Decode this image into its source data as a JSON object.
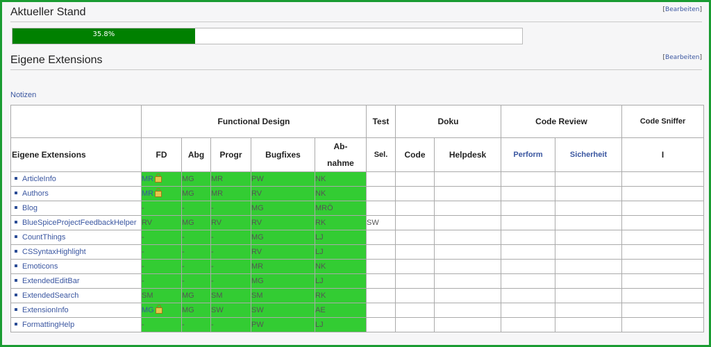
{
  "status": {
    "title": "Aktueller Stand",
    "edit_link": "Bearbeiten",
    "progress_label": "35.8%",
    "progress_value": 35.8
  },
  "extensions": {
    "title": "Eigene Extensions",
    "edit_link": "Bearbeiten",
    "notes_link": "Notizen"
  },
  "table": {
    "group_headers": [
      "Functional Design",
      "Test",
      "Doku",
      "Code Review",
      "Code Sniffer"
    ],
    "column_headers": [
      "Eigene Extensions",
      "FD",
      "Abg",
      "Progr",
      "Bugfixes",
      "Ab-",
      "nahme",
      "Sel.",
      "Code",
      "Helpdesk",
      "Perform",
      "Sicherheit",
      "I"
    ],
    "rows": [
      {
        "name": "ArticleInfo",
        "fd": "MR",
        "abg": "MG",
        "progr": "MR",
        "bugfixes": "PW",
        "abnahme": "NK",
        "test": ""
      },
      {
        "name": "Authors",
        "fd": "MR",
        "abg": "MG",
        "progr": "MR",
        "bugfixes": "RV",
        "abnahme": "NK",
        "test": ""
      },
      {
        "name": "Blog",
        "fd": "-",
        "abg": "-",
        "progr": "-",
        "bugfixes": "MG",
        "abnahme": "MRÖ",
        "test": ""
      },
      {
        "name": "BlueSpiceProjectFeedbackHelper",
        "fd": "RV",
        "abg": "MG",
        "progr": "RV",
        "bugfixes": "RV",
        "abnahme": "RK",
        "test": "SW"
      },
      {
        "name": "CountThings",
        "fd": "-",
        "abg": "-",
        "progr": "-",
        "bugfixes": "MG",
        "abnahme": "LJ",
        "test": ""
      },
      {
        "name": "CSSyntaxHighlight",
        "fd": "-",
        "abg": "-",
        "progr": "-",
        "bugfixes": "RV",
        "abnahme": "LJ",
        "test": ""
      },
      {
        "name": "Emoticons",
        "fd": "-",
        "abg": "-",
        "progr": "-",
        "bugfixes": "MR",
        "abnahme": "NK",
        "test": ""
      },
      {
        "name": "ExtendedEditBar",
        "fd": "-",
        "abg": "-",
        "progr": "-",
        "bugfixes": "MG",
        "abnahme": "LJ",
        "test": ""
      },
      {
        "name": "ExtendedSearch",
        "fd": "SM",
        "abg": "MG",
        "progr": "SM",
        "bugfixes": "SM",
        "abnahme": "RK",
        "test": ""
      },
      {
        "name": "ExtensionInfo",
        "fd": "MG",
        "abg": "MG",
        "progr": "SW",
        "bugfixes": "SW",
        "abnahme": "AE",
        "test": ""
      },
      {
        "name": "FormattingHelp",
        "fd": "-",
        "abg": "-",
        "progr": "-",
        "bugfixes": "PW",
        "abnahme": "LJ",
        "test": ""
      }
    ]
  },
  "colors": {
    "accent_green": "#33cc33",
    "progress_green": "#008000",
    "link_blue": "#3a56a0",
    "frame_green": "#1a9c32"
  }
}
